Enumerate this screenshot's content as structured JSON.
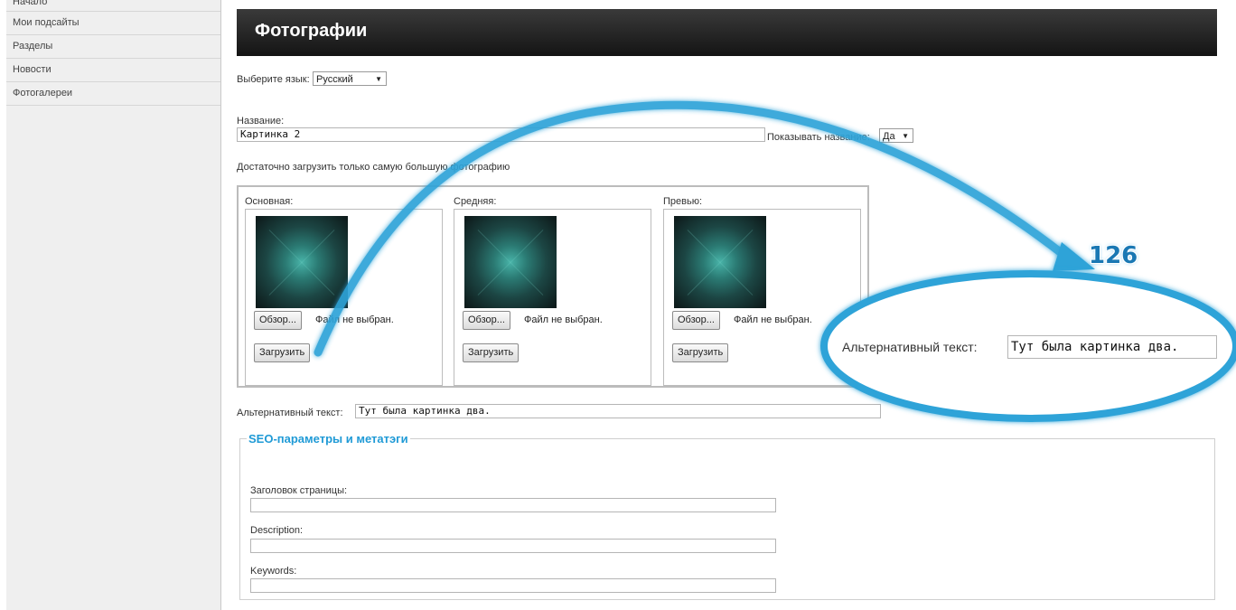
{
  "sidebar": {
    "items": [
      {
        "label": "Начало"
      },
      {
        "label": "Мои подсайты"
      },
      {
        "label": "Разделы"
      },
      {
        "label": "Новости"
      },
      {
        "label": "Фотогалереи"
      }
    ]
  },
  "header": {
    "title": "Фотографии"
  },
  "language": {
    "label": "Выберите язык:",
    "value": "Русский"
  },
  "name_field": {
    "label": "Название:",
    "value": "Картинка 2"
  },
  "show_name": {
    "label": "Показывать название:",
    "value": "Да"
  },
  "hint": "Достаточно загрузить только самую большую фотографию",
  "photos": [
    {
      "label": "Основная:",
      "browse": "Обзор...",
      "no_file": "Файл не выбран.",
      "upload": "Загрузить"
    },
    {
      "label": "Средняя:",
      "browse": "Обзор...",
      "no_file": "Файл не выбран.",
      "upload": "Загрузить"
    },
    {
      "label": "Превью:",
      "browse": "Обзор...",
      "no_file": "Файл не выбран.",
      "upload": "Загрузить"
    }
  ],
  "alt_text": {
    "label": "Альтернативный текст:",
    "value": "Тут была картинка два."
  },
  "seo": {
    "legend": "SEO-параметры и метатэги",
    "page_title_label": "Заголовок страницы:",
    "page_title_value": "",
    "description_label": "Description:",
    "description_value": "",
    "keywords_label": "Keywords:",
    "keywords_value": ""
  },
  "annotation": {
    "number": "126",
    "zoom_label": "Альтернативный текст:",
    "zoom_value": "Тут была картинка два.",
    "accent_color": "#2ea3d8"
  }
}
